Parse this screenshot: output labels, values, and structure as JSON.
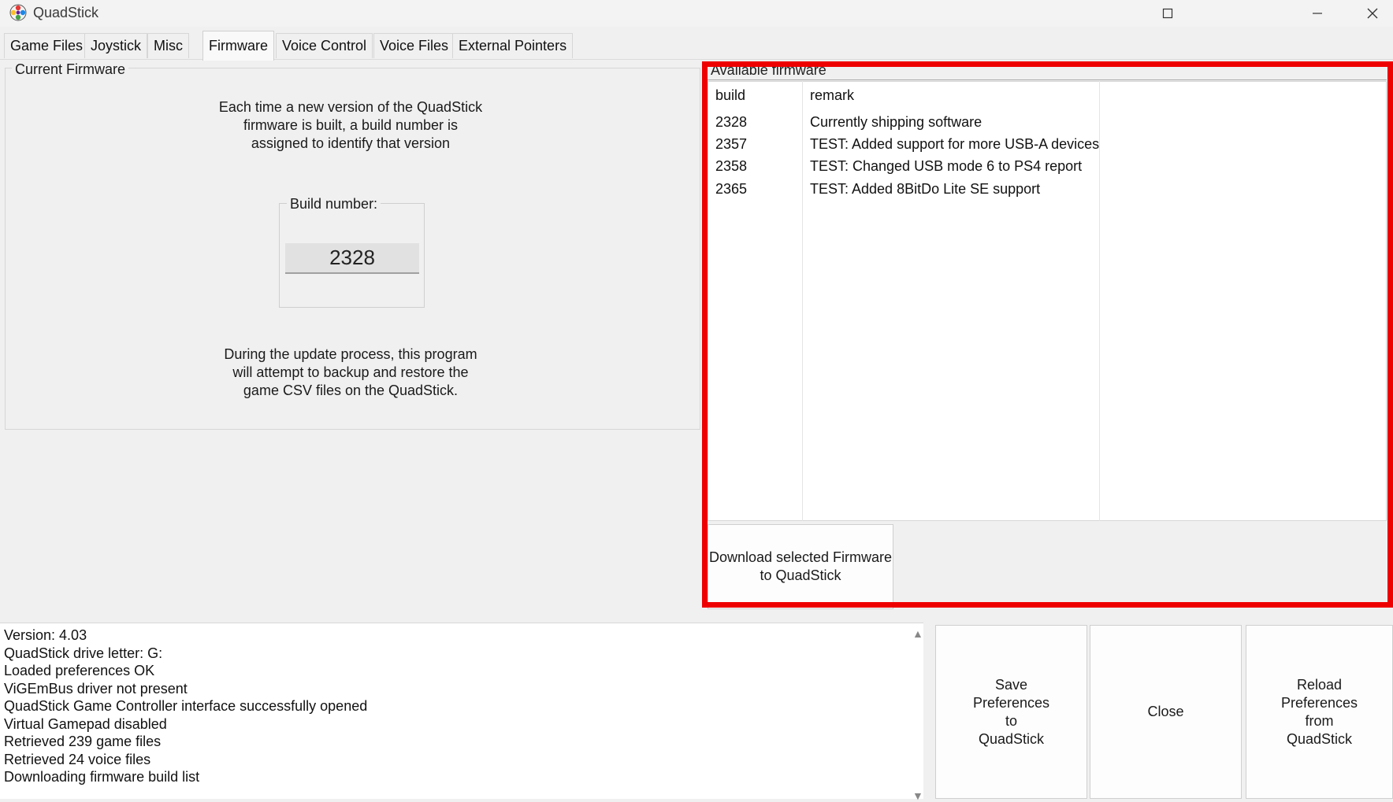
{
  "window": {
    "title": "QuadStick"
  },
  "tabs": [
    {
      "label": "Game Files"
    },
    {
      "label": "Joystick"
    },
    {
      "label": "Misc"
    },
    {
      "label": "Firmware"
    },
    {
      "label": "Voice Control"
    },
    {
      "label": "Voice Files"
    },
    {
      "label": "External Pointers"
    }
  ],
  "active_tab": "Firmware",
  "current_firmware": {
    "legend": "Current Firmware",
    "intro": [
      "Each time a new version of the QuadStick",
      "firmware is built, a build number is",
      "assigned to identify that version"
    ],
    "build_label": "Build number:",
    "build_value": "2328",
    "update_note": [
      "During the update process, this program",
      "will attempt to backup and restore the",
      "game CSV files on the QuadStick."
    ]
  },
  "available_firmware": {
    "legend": "Available firmware",
    "columns": [
      "build",
      "remark"
    ],
    "rows": [
      {
        "build": "2328",
        "remark": "Currently shipping software"
      },
      {
        "build": "2357",
        "remark": "TEST: Added support for more USB-A devices"
      },
      {
        "build": "2358",
        "remark": "TEST: Changed USB mode 6 to PS4 report"
      },
      {
        "build": "2365",
        "remark": "TEST: Added 8BitDo Lite SE support"
      }
    ],
    "download_button": [
      "Download selected Firmware",
      "to QuadStick"
    ]
  },
  "log_lines": [
    "Version: 4.03",
    "QuadStick drive letter: G:",
    "Loaded preferences OK",
    "ViGEmBus driver not present",
    "QuadStick Game Controller interface successfully opened",
    "Virtual Gamepad disabled",
    "Retrieved 239 game files",
    "Retrieved 24 voice files",
    "Downloading firmware build list"
  ],
  "buttons": {
    "save": [
      "Save",
      "Preferences",
      "to",
      "QuadStick"
    ],
    "close": [
      "Close"
    ],
    "reload": [
      "Reload",
      "Preferences",
      "from",
      "QuadStick"
    ]
  },
  "colors": {
    "highlight": "#ee0000",
    "list_bg": "#ffffff",
    "window_bg": "#f0f0f0"
  }
}
